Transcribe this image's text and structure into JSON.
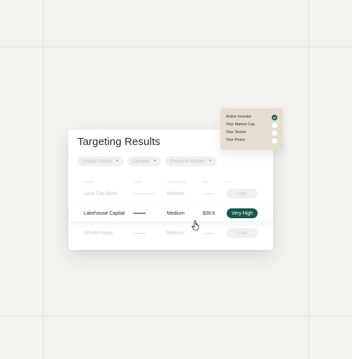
{
  "card": {
    "title": "Targeting Results",
    "filters": [
      {
        "label": "United States"
      },
      {
        "label": "Canada"
      },
      {
        "label": "Precious Metals"
      }
    ],
    "columns": [
      "NAME",
      "TYPE",
      "TURNOVER",
      "MV",
      "FIT"
    ],
    "rows": [
      {
        "name": "Lake City Bank",
        "type": "",
        "turnover": "Medium",
        "mv": "",
        "fit": "Low",
        "state": "faded"
      },
      {
        "name": "Lakehouse Capital",
        "type": "",
        "turnover": "Medium",
        "mv": "$39.6",
        "fit": "Very High",
        "state": "active"
      },
      {
        "name": "Whole Foods",
        "type": "",
        "turnover": "Medium",
        "mv": "",
        "fit": "Low",
        "state": "faded"
      }
    ]
  },
  "popover": {
    "items": [
      {
        "label": "Active Investor",
        "checked": true
      },
      {
        "label": "Your Market Cap",
        "checked": false
      },
      {
        "label": "Your Sector",
        "checked": false
      },
      {
        "label": "Your Peers",
        "checked": false
      }
    ]
  },
  "colors": {
    "accent": "#17584a",
    "background": "#f4f2ef",
    "popover": "#e4ded0"
  },
  "icons": {
    "cursor": "hand-pointer-icon",
    "check": "checkmark-icon",
    "caret": "caret-down-icon"
  }
}
